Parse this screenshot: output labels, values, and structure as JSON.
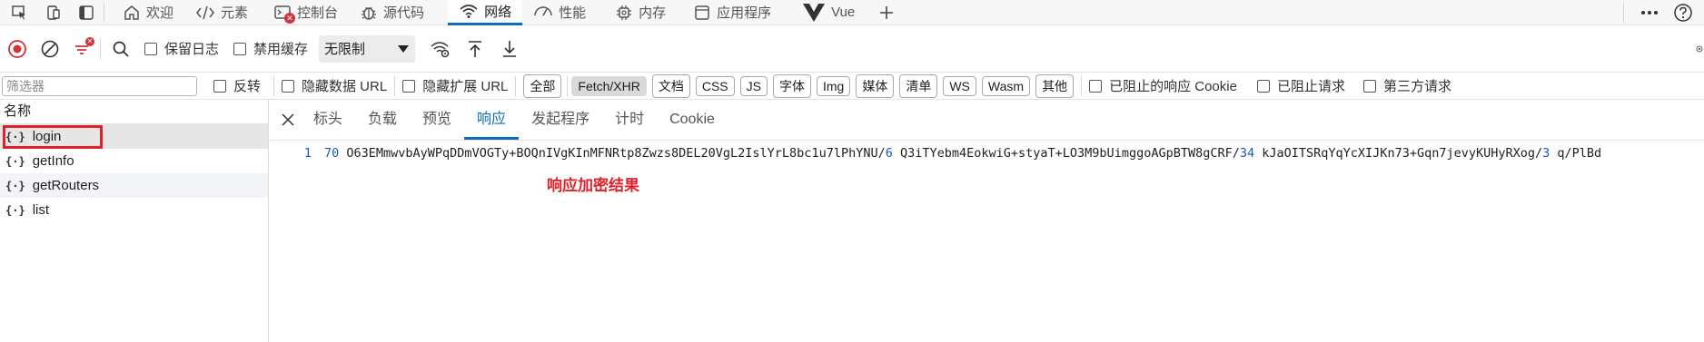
{
  "topbar": {
    "tabs": [
      {
        "label": "欢迎",
        "icon": "home-icon"
      },
      {
        "label": "元素",
        "icon": "code-icon"
      },
      {
        "label": "控制台",
        "icon": "console-icon"
      },
      {
        "label": "源代码",
        "icon": "bug-icon"
      },
      {
        "label": "网络",
        "icon": "wifi-icon",
        "active": true
      },
      {
        "label": "性能",
        "icon": "performance-icon"
      },
      {
        "label": "内存",
        "icon": "chip-icon"
      },
      {
        "label": "应用程序",
        "icon": "app-icon"
      },
      {
        "label": "Vue",
        "icon": "vue-icon"
      }
    ],
    "add_icon": "plus-icon",
    "more_icon": "ellipsis-icon",
    "help_icon": "help-icon"
  },
  "toolbar": {
    "preserve_log": "保留日志",
    "disable_cache": "禁用缓存",
    "throttle": "无限制"
  },
  "filterbar": {
    "placeholder": "筛选器",
    "invert": "反转",
    "hide_data_url": "隐藏数据 URL",
    "hide_ext_url": "隐藏扩展 URL",
    "types": [
      "全部",
      "Fetch/XHR",
      "文档",
      "CSS",
      "JS",
      "字体",
      "Img",
      "媒体",
      "清单",
      "WS",
      "Wasm",
      "其他"
    ],
    "active_type": "Fetch/XHR",
    "blocked_cookie": "已阻止的响应 Cookie",
    "blocked_requests": "已阻止请求",
    "third_party": "第三方请求"
  },
  "requests": {
    "header": "名称",
    "items": [
      "login",
      "getInfo",
      "getRouters",
      "list"
    ]
  },
  "details": {
    "tabs": [
      "标头",
      "负载",
      "预览",
      "响应",
      "发起程序",
      "计时",
      "Cookie"
    ],
    "active_tab": "响应",
    "line_number": "1",
    "segments": [
      {
        "t": "70",
        "num": true
      },
      {
        "t": " O63EMmwvbAyWPqDDmVOGTy+BOQnIVgKInMFNRtp8Zwzs8DEL20VgL2IslYrL8bc1u7lPhYNU/",
        "num": false
      },
      {
        "t": "6",
        "num": true
      },
      {
        "t": " Q3iTYebm4EokwiG+styaT+LO3M9bUimggoAGpBTW8gCRF/",
        "num": false
      },
      {
        "t": "34",
        "num": true
      },
      {
        "t": " kJaOITSRqYqYcXIJKn73+Gqn7jevyKUHyRXog/",
        "num": false
      },
      {
        "t": "3",
        "num": true
      },
      {
        "t": " q/PlBd",
        "num": false
      }
    ],
    "annotation": "响应加密结果"
  },
  "colors": {
    "accent": "#0f6cbd",
    "highlight": "#e0202a",
    "record": "#d13438"
  }
}
